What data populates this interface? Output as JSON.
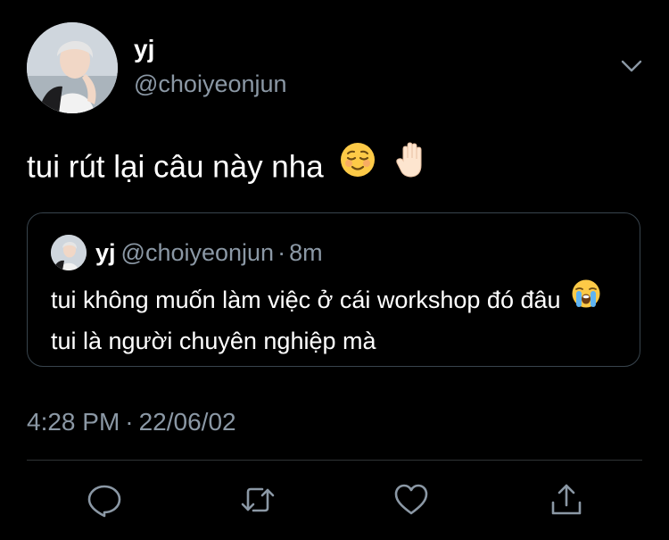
{
  "tweet": {
    "author": {
      "display_name": "yj",
      "handle": "@choiyeonjun"
    },
    "text": "tui rút lại câu này nha",
    "emojis": [
      "relieved-face-emoji",
      "raised-hand-emoji"
    ],
    "quoted": {
      "display_name": "yj",
      "handle": "@choiyeonjun",
      "separator": "·",
      "time_ago": "8m",
      "text_part1": "tui không muốn làm việc ở cái workshop đó đâu",
      "text_part2": "tui là người chuyên nghiệp mà",
      "emoji": "loudly-crying-face-emoji"
    },
    "time": "4:28 PM",
    "separator": "·",
    "date": "22/06/02"
  },
  "actions": [
    "reply-icon",
    "retweet-icon",
    "like-icon",
    "share-icon"
  ],
  "colors": {
    "background": "#000000",
    "primary_text": "#ffffff",
    "secondary_text": "#8b98a5",
    "border": "#38444d",
    "emoji_yellow": "#fdca47",
    "hand_skin": "#fde5cf"
  }
}
